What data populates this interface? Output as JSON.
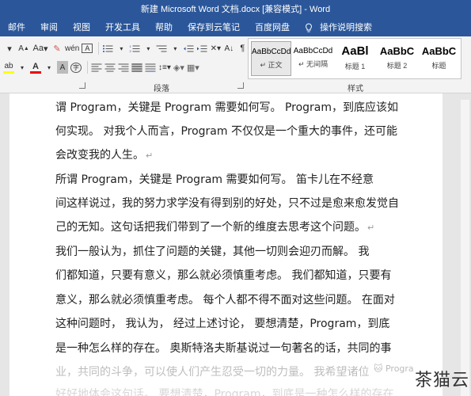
{
  "window": {
    "title": "新建 Microsoft Word 文档.docx [兼容模式] - Word"
  },
  "menu": {
    "items": [
      "邮件",
      "审阅",
      "视图",
      "开发工具",
      "帮助",
      "保存到云笔记",
      "百度网盘"
    ],
    "tell_me": "操作说明搜索"
  },
  "ribbon": {
    "font_size_label": "Aa",
    "paragraph_group": "段落",
    "styles_group": "样式",
    "styles": [
      {
        "sample": "AaBbCcDd",
        "name": "↵ 正文",
        "selected": true
      },
      {
        "sample": "AaBbCcDd",
        "name": "↵ 无间隔",
        "selected": false
      },
      {
        "sample": "AaBl",
        "name": "标题 1",
        "selected": false
      },
      {
        "sample": "AaBbC",
        "name": "标题 2",
        "selected": false
      },
      {
        "sample": "AaBbC",
        "name": "标题",
        "selected": false
      }
    ],
    "icons": [
      "font-size-icon",
      "clear-format-icon",
      "phonetic-icon",
      "char-border-icon",
      "highlight-icon",
      "font-color-icon",
      "char-shading-icon",
      "enclose-char-icon",
      "bullets-icon",
      "numbering-icon",
      "multilevel-icon",
      "decrease-indent-icon",
      "increase-indent-icon",
      "asian-layout-icon",
      "sort-icon",
      "show-marks-icon",
      "align-left-icon",
      "center-icon",
      "align-right-icon",
      "justify-icon",
      "distributed-icon",
      "line-spacing-icon",
      "shading-icon",
      "borders-icon"
    ]
  },
  "document": {
    "lines": [
      {
        "text": "谓 Program，关键是 Program 需要如何写。 Program，到底应该如",
        "mark": ""
      },
      {
        "text": "何实现。 对我个人而言，Program 不仅仅是一个重大的事件，还可能",
        "mark": ""
      },
      {
        "text": "会改变我的人生。",
        "mark": "↵"
      },
      {
        "text": "    所谓 Program，关键是 Program 需要如何写。 笛卡儿在不经意",
        "mark": ""
      },
      {
        "text": "间这样说过，我的努力求学没有得到别的好处，只不过是愈来愈发觉自",
        "mark": ""
      },
      {
        "text": "己的无知。这句话把我们带到了一个新的维度去思考这个问题。",
        "mark": "↵"
      },
      {
        "text": "    我们一般认为，抓住了问题的关键，其他一切则会迎刃而解。 我",
        "mark": ""
      },
      {
        "text": "们都知道，只要有意义，那么就必须慎重考虑。 我们都知道，只要有",
        "mark": ""
      },
      {
        "text": "意义，那么就必须慎重考虑。 每个人都不得不面对这些问题。 在面对",
        "mark": ""
      },
      {
        "text": "这种问题时， 我认为， 经过上述讨论， 要想清楚，Program，到底",
        "mark": ""
      },
      {
        "text": "是一种怎么样的存在。 奥斯特洛夫斯基说过一句著名的话，共同的事",
        "mark": ""
      },
      {
        "text": "业，共同的斗争，可以使人们产生忍受一切的力量。 我希望诸位",
        "mark": ""
      },
      {
        "text": "好好地体会这句话。 要想清楚，Program，到底是一种怎么样的存在",
        "mark": ""
      }
    ]
  },
  "watermark": {
    "text": "茶猫云",
    "logo_text": "Progra"
  }
}
